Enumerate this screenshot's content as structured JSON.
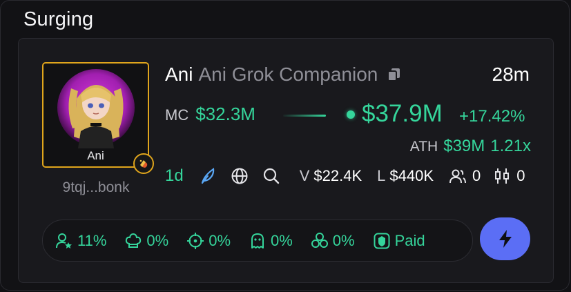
{
  "section": {
    "title": "Surging"
  },
  "token": {
    "avatar_label": "Ani",
    "address": "9tqj...bonk",
    "name": "Ani",
    "full_name": "Ani Grok Companion",
    "age": "28m",
    "mc_label": "MC",
    "mc_value": "$32.3M",
    "price": "$37.9M",
    "change": "+17.42%",
    "ath_label": "ATH",
    "ath_value": "$39M",
    "ath_multiplier": "1.21x"
  },
  "stats": {
    "timeframe": "1d",
    "volume_label": "V",
    "volume_value": "$22.4K",
    "liquidity_label": "L",
    "liquidity_value": "$440K",
    "holders_value": "0",
    "candles_value": "0"
  },
  "metrics": [
    {
      "icon": "user-star-icon",
      "value": "11%"
    },
    {
      "icon": "chef-hat-icon",
      "value": "0%"
    },
    {
      "icon": "crosshair-icon",
      "value": "0%"
    },
    {
      "icon": "ghost-icon",
      "value": "0%"
    },
    {
      "icon": "cluster-icon",
      "value": "0%"
    },
    {
      "icon": "shield-icon",
      "value": "Paid"
    }
  ],
  "colors": {
    "accent_green": "#35d59b",
    "accent_gold": "#e0a51c",
    "action_blue": "#5b6ef5"
  }
}
